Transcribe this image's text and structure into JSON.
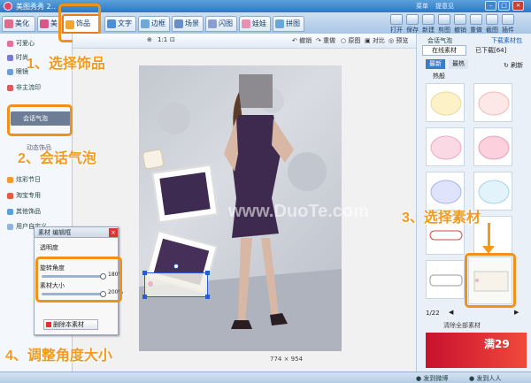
{
  "window": {
    "title": "美图秀秀 2..",
    "menu": [
      "菜单",
      "提意见"
    ]
  },
  "tabs": [
    {
      "label": "美化",
      "color": "#e06b8e"
    },
    {
      "label": "美",
      "color": "#d9568a"
    },
    {
      "label": "饰品",
      "color": "#f3a532",
      "active": true
    },
    {
      "label": "文字",
      "color": "#4a90d9"
    },
    {
      "label": "边框",
      "color": "#6fa7da"
    },
    {
      "label": "场景",
      "color": "#6a8fc6"
    },
    {
      "label": "闪图",
      "color": "#8a9fd0"
    },
    {
      "label": "娃娃",
      "color": "#e88fb3"
    },
    {
      "label": "拼图",
      "color": "#68a8d8"
    }
  ],
  "right_tools": [
    "打开",
    "保存",
    "新建",
    "剪图",
    "撤销",
    "重做",
    "截图",
    "插件"
  ],
  "left_items": [
    {
      "label": "可爱心",
      "color": "#e86f9d"
    },
    {
      "label": "时尚",
      "color": "#7a7ad6"
    },
    {
      "label": "眼镜",
      "color": "#6aa0d8"
    },
    {
      "label": "非主流印",
      "color": "#d95b5b"
    }
  ],
  "left_items_lower": [
    {
      "label": "炫彩节日",
      "color": "#f29b2c"
    },
    {
      "label": "淘宝专用",
      "color": "#e85a3c"
    },
    {
      "label": "其他饰品",
      "color": "#5aa0d8"
    },
    {
      "label": "用户自定义",
      "color": "#8fb5de"
    }
  ],
  "left_selected": "会话气泡",
  "left_partial": "动态饰品",
  "canvas_toolbar": {
    "undo": "撤销",
    "redo": "重做",
    "original": "原图",
    "compare": "对比",
    "preview": "预览",
    "zoom": "1:1"
  },
  "canvas_size": "774 × 954",
  "watermark": "www.DuoTe.com",
  "popup": {
    "title": "素材 编辑框",
    "opacity_label": "透明度",
    "rotate_label": "旋转角度",
    "rotate_value": "180°",
    "size_label": "素材大小",
    "size_value": "200%",
    "delete_label": "删除本素材"
  },
  "right_panel": {
    "header": "会话气泡",
    "download": "下载素材包",
    "tab_online": "在线素材",
    "tab_downloaded": "已下载[64]",
    "sub_new": "最新",
    "sub_hot": "最热",
    "hot_label": "热般",
    "refresh": "刷新",
    "page": "1/22",
    "clear": "清除全部素材"
  },
  "callouts": {
    "c1": "1、选择饰品",
    "c2": "2、会话气泡",
    "c3": "3、选择素材",
    "c4": "4、调整角度大小"
  },
  "status": {
    "left": "",
    "weibo": "发到微博",
    "renren": "发到人人",
    "badge": "满29"
  }
}
